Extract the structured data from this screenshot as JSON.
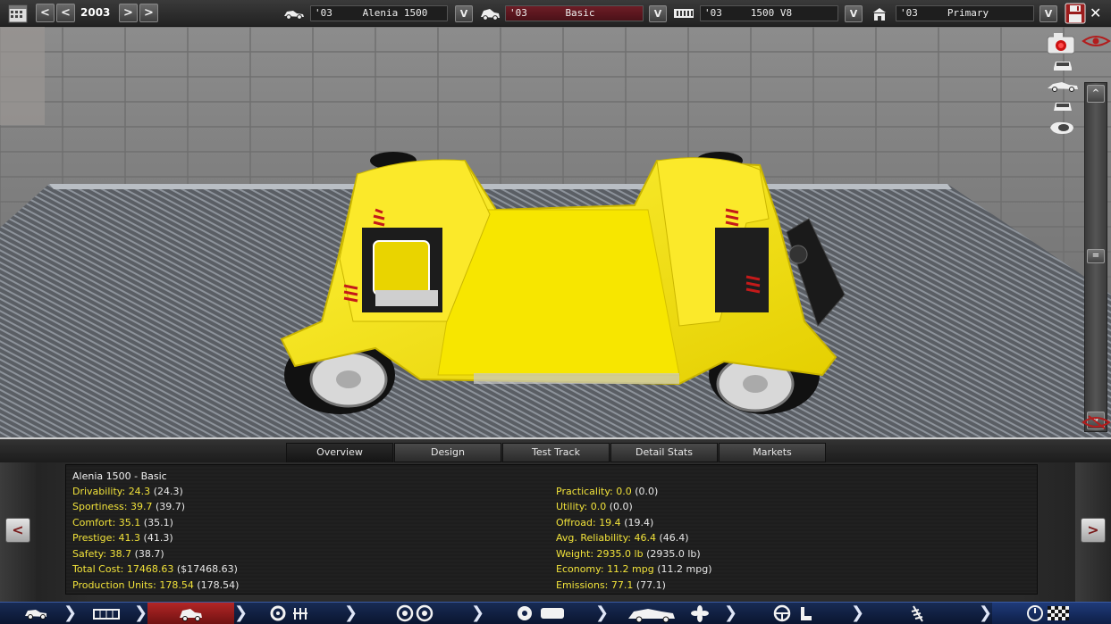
{
  "toolbar": {
    "year": "2003",
    "prev_label": "<",
    "prev2_label": "<",
    "next_label": ">",
    "next2_label": ">",
    "dropdown_label": "V",
    "fields": [
      {
        "year": "'03",
        "name": "Alenia 1500",
        "icon": "car-model-icon"
      },
      {
        "year": "'03",
        "name": "Basic",
        "icon": "car-trim-icon"
      },
      {
        "year": "'03",
        "name": "1500 V8",
        "icon": "engine-icon"
      },
      {
        "year": "'03",
        "name": "Primary",
        "icon": "factory-icon"
      }
    ],
    "save_icon": "save-icon",
    "close_label": "✕"
  },
  "view_tools": {
    "items": [
      "camera-icon",
      "car-front-icon",
      "car-side-icon",
      "car-rear-icon",
      "car-top-icon"
    ],
    "scroll_up": "^",
    "scroll_down": "v"
  },
  "tabs": [
    {
      "label": "Overview",
      "active": true
    },
    {
      "label": "Design",
      "active": false
    },
    {
      "label": "Test Track",
      "active": false
    },
    {
      "label": "Detail Stats",
      "active": false
    },
    {
      "label": "Markets",
      "active": false
    }
  ],
  "panel": {
    "title": "Alenia 1500 - Basic",
    "prev_label": "<",
    "next_label": ">",
    "left_stats": [
      {
        "label": "Drivability:",
        "value": "24.3",
        "paren": "(24.3)"
      },
      {
        "label": "Sportiness:",
        "value": "39.7",
        "paren": "(39.7)"
      },
      {
        "label": "Comfort:",
        "value": "35.1",
        "paren": "(35.1)"
      },
      {
        "label": "Prestige:",
        "value": "41.3",
        "paren": "(41.3)"
      },
      {
        "label": "Safety:",
        "value": "38.7",
        "paren": "(38.7)"
      },
      {
        "label": "Total Cost:",
        "value": "17468.63",
        "paren": "($17468.63)"
      },
      {
        "label": "Production Units:",
        "value": "178.54",
        "paren": "(178.54)"
      }
    ],
    "right_stats": [
      {
        "label": "Practicality:",
        "value": "0.0",
        "paren": "(0.0)"
      },
      {
        "label": "Utility:",
        "value": "0.0",
        "paren": "(0.0)"
      },
      {
        "label": "Offroad:",
        "value": "19.4",
        "paren": "(19.4)"
      },
      {
        "label": "Avg. Reliability:",
        "value": "46.4",
        "paren": "(46.4)"
      },
      {
        "label": "Weight:",
        "value": "2935.0 lb",
        "paren": "(2935.0 lb)"
      },
      {
        "label": "Economy:",
        "value": "11.2 mpg",
        "paren": "(11.2 mpg)"
      },
      {
        "label": "Emissions:",
        "value": "77.1",
        "paren": "(77.1)"
      }
    ]
  },
  "bottom_nav": [
    {
      "icon": "car-design-icon",
      "active": false
    },
    {
      "icon": "chassis-icon",
      "active": false
    },
    {
      "icon": "body-icon",
      "active": true
    },
    {
      "icon": "engine-gearbox-icon",
      "active": false
    },
    {
      "icon": "wheels-icon",
      "active": false
    },
    {
      "icon": "brakes-icon",
      "active": false
    },
    {
      "icon": "aero-icon",
      "active": false
    },
    {
      "icon": "interior-icon",
      "active": false
    },
    {
      "icon": "suspension-icon",
      "active": false
    },
    {
      "icon": "finish-icon",
      "active": false
    }
  ],
  "colors": {
    "stat_yellow": "#f1e23a",
    "active_red": "#8a1e1e",
    "car_yellow": "#f5e000",
    "nav_blue": "#13234a"
  }
}
